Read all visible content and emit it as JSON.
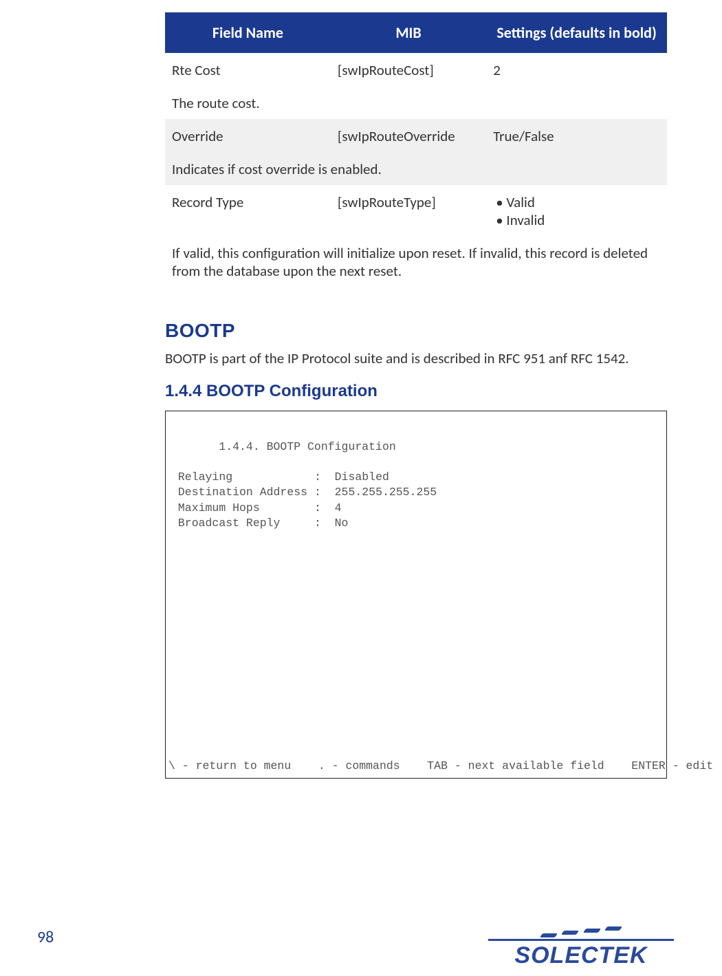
{
  "table": {
    "headers": [
      "Field Name",
      "MIB",
      "Settings (defaults in bold)"
    ],
    "rows": [
      {
        "field": "Rte Cost",
        "mib": "[swIpRouteCost]",
        "setting": "2",
        "desc": "The route cost.",
        "shaded": false
      },
      {
        "field": "Override",
        "mib": "[swIpRouteOverride",
        "setting": "True/False",
        "desc": "Indicates if cost override is enabled.",
        "shaded": true
      },
      {
        "field": "Record Type",
        "mib": "[swIpRouteType]",
        "setting_list": [
          "Valid",
          "Invalid"
        ],
        "desc": "If valid, this configuration will initialize upon reset. If invalid, this record is deleted from the database upon the next reset.",
        "shaded": false
      }
    ]
  },
  "section": {
    "title": "BOOTP",
    "body": "BOOTP is part of the IP Protocol suite and is described in RFC 951 anf RFC 1542."
  },
  "subsection": {
    "title": "1.4.4 BOOTP Configuration"
  },
  "terminal": {
    "title": "       1.4.4. BOOTP Configuration",
    "rows": [
      {
        "label": "Relaying            :",
        "value": "Disabled"
      },
      {
        "label": "Destination Address :",
        "value": "255.255.255.255"
      },
      {
        "label": "Maximum Hops        :",
        "value": "4"
      },
      {
        "label": "Broadcast Reply     :",
        "value": "No"
      }
    ],
    "footer": "\\ - return to menu    . - commands    TAB - next available field    ENTER - edit"
  },
  "page_number": "98",
  "logo_text": "SOLECTEK"
}
